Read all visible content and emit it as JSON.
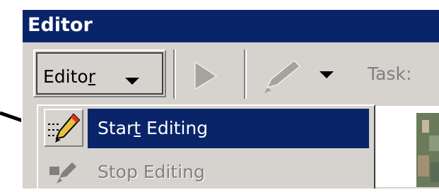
{
  "window": {
    "title": "Editor"
  },
  "toolbar": {
    "editor_menu_label": "Editor",
    "editor_menu_accel": "r",
    "task_label": "Task:"
  },
  "menu": {
    "items": [
      {
        "label_pre": "Star",
        "label_accel": "t",
        "label_post": " Editing",
        "state": "selected",
        "icon": "start-editing-icon"
      },
      {
        "label": "Stop Editing",
        "state": "disabled",
        "icon": "stop-editing-icon"
      }
    ]
  },
  "colors": {
    "titlebar": "#0a246a",
    "face": "#d6d3ce",
    "selection": "#0a246a",
    "arrow": "#000000"
  }
}
